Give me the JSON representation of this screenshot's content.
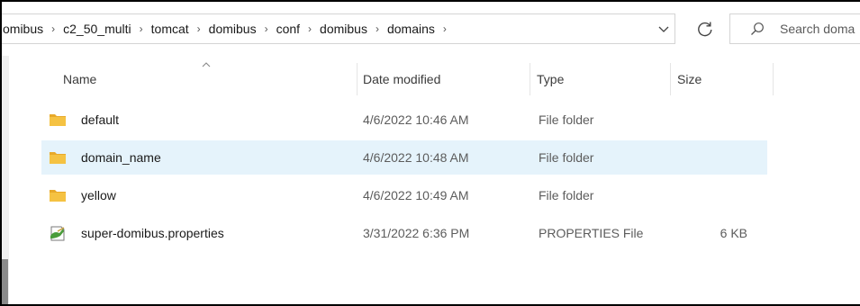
{
  "address_bar": {
    "breadcrumbs": [
      "omibus",
      "c2_50_multi",
      "tomcat",
      "domibus",
      "conf",
      "domibus",
      "domains"
    ],
    "search_placeholder": "Search doma"
  },
  "columns": {
    "name": "Name",
    "date": "Date modified",
    "type": "Type",
    "size": "Size"
  },
  "files": [
    {
      "name": "default",
      "date": "4/6/2022 10:46 AM",
      "type": "File folder",
      "size": "",
      "icon": "folder-icon"
    },
    {
      "name": "domain_name",
      "date": "4/6/2022 10:48 AM",
      "type": "File folder",
      "size": "",
      "icon": "folder-icon",
      "selected": true
    },
    {
      "name": "yellow",
      "date": "4/6/2022 10:49 AM",
      "type": "File folder",
      "size": "",
      "icon": "folder-icon"
    },
    {
      "name": "super-domibus.properties",
      "date": "3/31/2022 6:36 PM",
      "type": "PROPERTIES File",
      "size": "6 KB",
      "icon": "properties-file-icon"
    }
  ],
  "colors": {
    "selected_row": "#e5f3fb",
    "folder": "#f5c242"
  }
}
